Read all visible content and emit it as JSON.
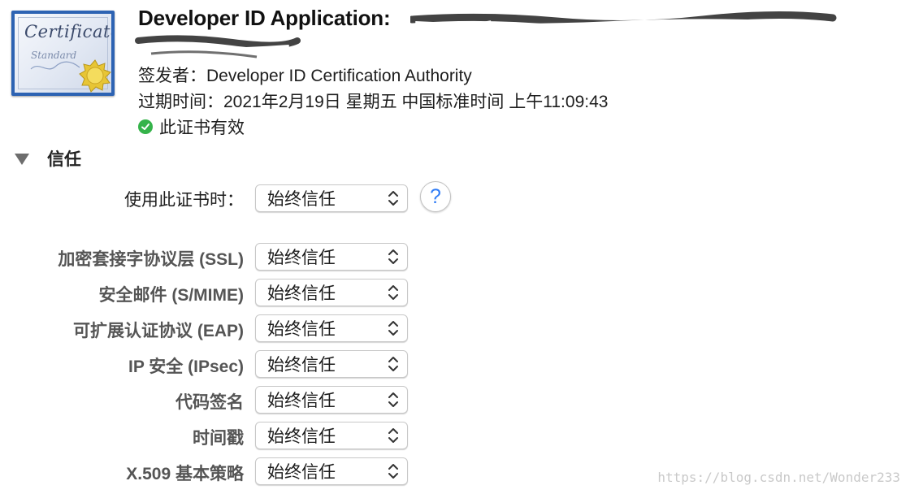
{
  "certificate": {
    "icon_text_main": "Certificate",
    "icon_text_sub": "Standard",
    "title": "Developer ID Application:",
    "issuer": "签发者：Developer ID Certification Authority",
    "expiry": "过期时间：2021年2月19日 星期五 中国标准时间 上午11:09:43",
    "status": "此证书有效",
    "status_color": "#35b34a"
  },
  "trust": {
    "section_label": "信任",
    "when_using_label": "使用此证书时：",
    "when_using_value": "始终信任",
    "help_symbol": "?",
    "rows": [
      {
        "label": "加密套接字协议层 (SSL)",
        "value": "始终信任"
      },
      {
        "label": "安全邮件 (S/MIME)",
        "value": "始终信任"
      },
      {
        "label": "可扩展认证协议 (EAP)",
        "value": "始终信任"
      },
      {
        "label": "IP 安全 (IPsec)",
        "value": "始终信任"
      },
      {
        "label": "代码签名",
        "value": "始终信任"
      },
      {
        "label": "时间戳",
        "value": "始终信任"
      },
      {
        "label": "X.509 基本策略",
        "value": "始终信任"
      }
    ]
  },
  "watermark": "https://blog.csdn.net/Wonder233",
  "colors": {
    "accent": "#2f7cf6",
    "icon_border": "#2d63b3"
  }
}
